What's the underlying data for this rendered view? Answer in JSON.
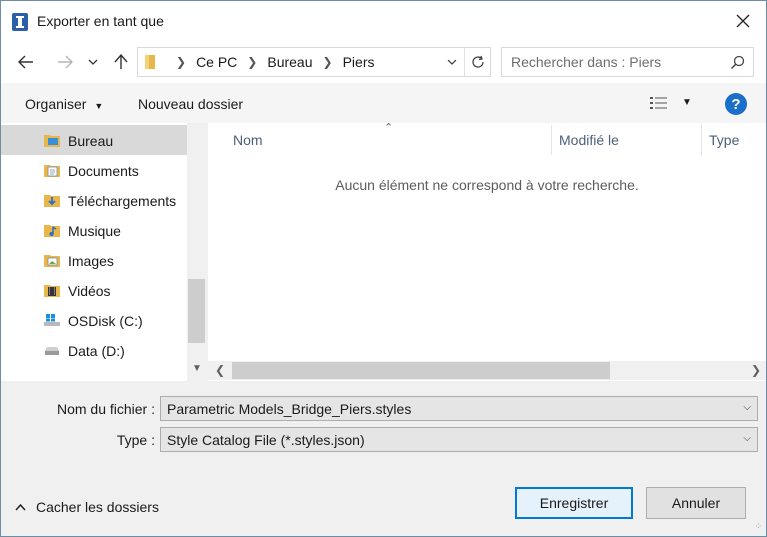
{
  "window": {
    "title": "Exporter en tant que"
  },
  "address": {
    "crumbs": [
      "Ce PC",
      "Bureau",
      "Piers"
    ]
  },
  "search": {
    "placeholder": "Rechercher dans : Piers"
  },
  "toolbar": {
    "organize": "Organiser",
    "new_folder": "Nouveau dossier"
  },
  "sidebar": {
    "items": [
      {
        "label": "Bureau",
        "icon": "desktop-folder-icon",
        "selected": true
      },
      {
        "label": "Documents",
        "icon": "documents-icon"
      },
      {
        "label": "Téléchargements",
        "icon": "downloads-icon"
      },
      {
        "label": "Musique",
        "icon": "music-icon"
      },
      {
        "label": "Images",
        "icon": "pictures-icon"
      },
      {
        "label": "Vidéos",
        "icon": "videos-icon"
      },
      {
        "label": "OSDisk (C:)",
        "icon": "windows-drive-icon"
      },
      {
        "label": "Data (D:)",
        "icon": "drive-icon"
      }
    ]
  },
  "columns": [
    "Nom",
    "Modifié le",
    "Type"
  ],
  "main": {
    "empty_message": "Aucun élément ne correspond à votre recherche."
  },
  "form": {
    "filename_label": "Nom du fichier :",
    "filename_value": "Parametric Models_Bridge_Piers.styles",
    "type_label": "Type :",
    "type_value": "Style Catalog File (*.styles.json)"
  },
  "footer": {
    "hide_folders": "Cacher les dossiers",
    "save": "Enregistrer",
    "cancel": "Annuler"
  },
  "colors": {
    "accent": "#0078d7",
    "folder": "#e8b64a",
    "help": "#1a6fc9"
  }
}
